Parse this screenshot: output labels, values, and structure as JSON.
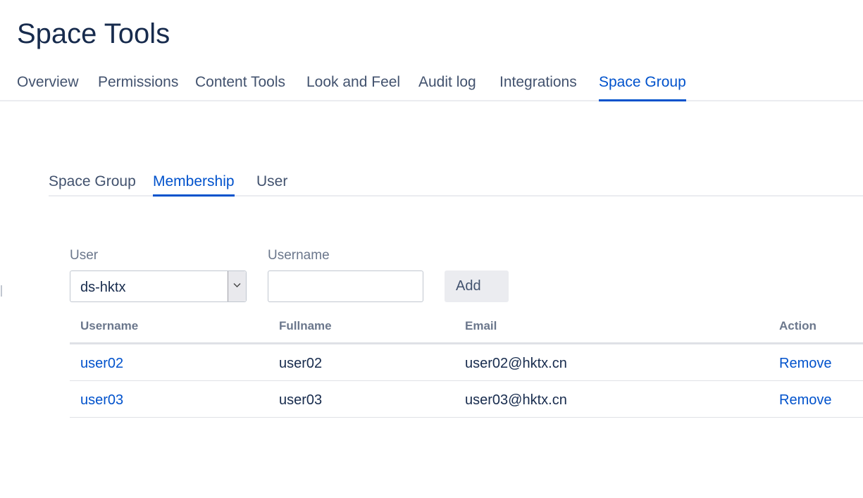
{
  "page": {
    "title": "Space Tools"
  },
  "main_tabs": [
    {
      "label": "Overview",
      "active": false
    },
    {
      "label": "Permissions",
      "active": false
    },
    {
      "label": "Content Tools",
      "active": false
    },
    {
      "label": "Look and Feel",
      "active": false
    },
    {
      "label": "Audit log",
      "active": false
    },
    {
      "label": "Integrations",
      "active": false
    },
    {
      "label": "Space Group",
      "active": true
    }
  ],
  "sub_tabs": [
    {
      "label": "Space Group",
      "active": false
    },
    {
      "label": "Membership",
      "active": true
    },
    {
      "label": "User",
      "active": false
    }
  ],
  "form": {
    "user_label": "User",
    "user_selected": "ds-hktx",
    "username_label": "Username",
    "username_value": "",
    "username_placeholder": "",
    "add_label": "Add"
  },
  "table": {
    "headers": {
      "username": "Username",
      "fullname": "Fullname",
      "email": "Email",
      "action": "Action"
    },
    "rows": [
      {
        "username": "user02",
        "fullname": "user02",
        "email": "user02@hktx.cn",
        "action": "Remove"
      },
      {
        "username": "user03",
        "fullname": "user03",
        "email": "user03@hktx.cn",
        "action": "Remove"
      }
    ]
  },
  "colors": {
    "accent": "#0052cc",
    "text": "#172b4d",
    "muted": "#42526e",
    "subtle": "#6b778c",
    "border": "#ebecf0"
  },
  "icons": {
    "select_arrow": "chevron-down-icon"
  }
}
